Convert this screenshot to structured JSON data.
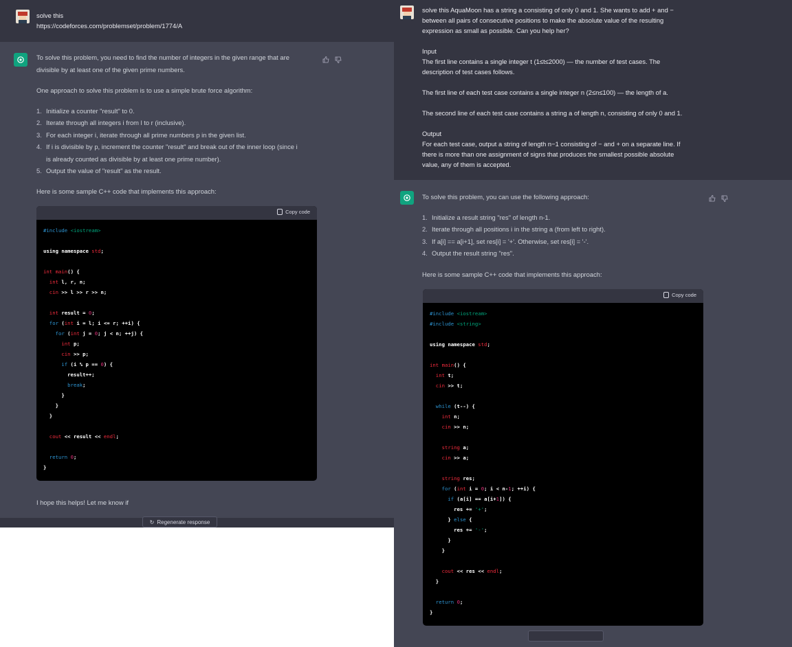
{
  "left": {
    "user_message_line1": "solve this",
    "user_message_line2": "https://codeforces.com/problemset/problem/1774/A",
    "intro_line1": "To solve this problem, you need to find the number of integers in the given range that are",
    "intro_line2": "divisible by at least one of the given prime numbers.",
    "approach": "One approach to solve this problem is to use a simple brute force algorithm:",
    "steps": [
      {
        "num": "1.",
        "text": "Initialize a counter \"result\" to 0."
      },
      {
        "num": "2.",
        "text": "Iterate through all integers i from l to r (inclusive)."
      },
      {
        "num": "3.",
        "text": "For each integer i, iterate through all prime numbers p in the given list."
      },
      {
        "num": "4.",
        "text": "If i is divisible by p, increment the counter \"result\" and break out of the inner loop (since i"
      },
      {
        "num": "",
        "text": "is already counted as divisible by at least one prime number)."
      },
      {
        "num": "5.",
        "text": "Output the value of \"result\" as the result."
      }
    ],
    "sample_intro": "Here is some sample C++ code that implements this approach:",
    "copy_label": "Copy code",
    "closing": "I hope this helps! Let me know if",
    "regenerate_label": "Regenerate response"
  },
  "right": {
    "user_lines": [
      "solve this AquaMoon has a string a consisting of only 0 and 1. She wants to add + and −",
      "between all pairs of consecutive positions to make the absolute value of the resulting",
      "expression as small as possible. Can you help her?",
      "",
      "Input",
      "The first line contains a single integer t (1≤t≤2000) — the number of test cases. The",
      "description of test cases follows.",
      "",
      "The first line of each test case contains a single integer n (2≤n≤100) — the length of a.",
      "",
      "The second line of each test case contains a string a of length n, consisting of only 0 and 1.",
      "",
      "Output",
      "For each test case, output a string of length n−1 consisting of − and + on a separate line. If",
      "there is more than one assignment of signs that produces the smallest possible absolute",
      "value, any of them is accepted."
    ],
    "intro": "To solve this problem, you can use the following approach:",
    "steps": [
      {
        "num": "1.",
        "text": "Initialize a result string \"res\" of length n-1."
      },
      {
        "num": "2.",
        "text": "Iterate through all positions i in the string a (from left to right)."
      },
      {
        "num": "3.",
        "text": "If a[i] == a[i+1], set res[i] = '+'. Otherwise, set res[i] = '-'."
      },
      {
        "num": "4.",
        "text": "Output the result string \"res\"."
      }
    ],
    "sample_intro": "Here is some sample C++ code that implements this approach:",
    "copy_label": "Copy code"
  },
  "colors": {
    "user_bg": "#343541",
    "assistant_bg": "#444654",
    "gpt_green": "#10a37f",
    "code_bg": "#000000"
  }
}
